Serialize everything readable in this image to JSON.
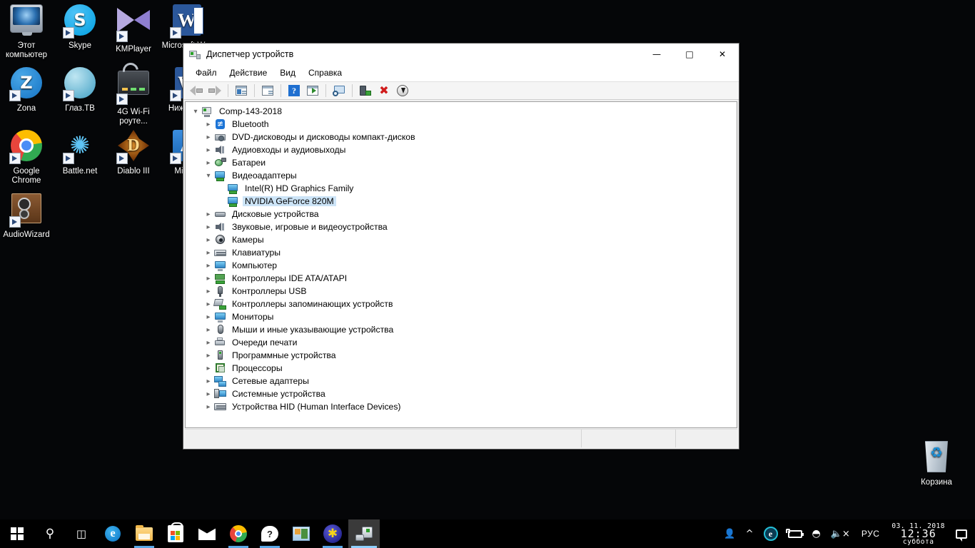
{
  "desktop": {
    "icons": [
      {
        "label": "Этот компьютер",
        "icon": "this-pc-icon",
        "shortcut": false
      },
      {
        "label": "Skype",
        "icon": "skype-icon",
        "shortcut": true
      },
      {
        "label": "KMPlayer",
        "icon": "kmplayer-icon",
        "shortcut": true
      },
      {
        "label": "Microsoft Wor",
        "icon": "microsoft-word-icon",
        "shortcut": true
      },
      {
        "label": "Zona",
        "icon": "zona-icon",
        "shortcut": true
      },
      {
        "label": "Глаз.ТВ",
        "icon": "glaz-tv-icon",
        "shortcut": true
      },
      {
        "label": "4G Wi-Fi роуте...",
        "icon": "wifi-router-icon",
        "shortcut": true
      },
      {
        "label": "Ниж Лелн",
        "icon": "word-doc-icon",
        "shortcut": true
      },
      {
        "label": "Google Chrome",
        "icon": "chrome-icon",
        "shortcut": true
      },
      {
        "label": "Battle.net",
        "icon": "battlenet-icon",
        "shortcut": true
      },
      {
        "label": "Diablo III",
        "icon": "diablo-icon",
        "shortcut": true
      },
      {
        "label": "Mic Ed",
        "icon": "microsoft-edge-blue-icon",
        "shortcut": true
      },
      {
        "label": "AudioWizard",
        "icon": "audiowizard-icon",
        "shortcut": true
      },
      {
        "label": "Корзина",
        "icon": "recycle-bin-icon",
        "shortcut": false
      }
    ]
  },
  "window": {
    "title": "Диспетчер устройств",
    "title_icon": "device-manager-icon",
    "controls": {
      "minimize": "—",
      "maximize": "□",
      "close": "✕"
    },
    "menu": [
      "Файл",
      "Действие",
      "Вид",
      "Справка"
    ],
    "toolbar": [
      {
        "name": "back-button",
        "icon": "arrow-left-icon"
      },
      {
        "name": "forward-button",
        "icon": "arrow-right-icon"
      },
      {
        "name": "separator-1",
        "icon": "separator"
      },
      {
        "name": "show-hide-console-tree-button",
        "icon": "console-tree-icon"
      },
      {
        "name": "separator-2",
        "icon": "separator"
      },
      {
        "name": "properties-button",
        "icon": "properties-icon"
      },
      {
        "name": "separator-3",
        "icon": "separator"
      },
      {
        "name": "help-button",
        "icon": "help-icon"
      },
      {
        "name": "update-driver-button",
        "icon": "update-driver-icon"
      },
      {
        "name": "separator-4",
        "icon": "separator"
      },
      {
        "name": "scan-hardware-changes-button",
        "icon": "scan-hardware-icon"
      },
      {
        "name": "separator-5",
        "icon": "separator"
      },
      {
        "name": "enable-device-button",
        "icon": "enable-device-icon"
      },
      {
        "name": "uninstall-device-button",
        "icon": "uninstall-red-x-icon"
      },
      {
        "name": "disable-device-button",
        "icon": "disable-device-icon"
      }
    ],
    "tree": [
      {
        "label": "Comp-143-2018",
        "depth": 0,
        "state": "expanded",
        "icon": "computer-node-icon",
        "selected": false
      },
      {
        "label": "Bluetooth",
        "depth": 1,
        "state": "collapsed",
        "icon": "bluetooth-icon",
        "selected": false
      },
      {
        "label": "DVD-дисководы и дисководы компакт-дисков",
        "depth": 1,
        "state": "collapsed",
        "icon": "dvd-drive-icon",
        "selected": false
      },
      {
        "label": "Аудиовходы и аудиовыходы",
        "depth": 1,
        "state": "collapsed",
        "icon": "audio-io-icon",
        "selected": false
      },
      {
        "label": "Батареи",
        "depth": 1,
        "state": "collapsed",
        "icon": "battery-icon",
        "selected": false
      },
      {
        "label": "Видеоадаптеры",
        "depth": 1,
        "state": "expanded",
        "icon": "display-adapter-icon",
        "selected": false
      },
      {
        "label": "Intel(R) HD Graphics Family",
        "depth": 2,
        "state": "leaf",
        "icon": "display-adapter-icon",
        "selected": false
      },
      {
        "label": "NVIDIA GeForce 820M",
        "depth": 2,
        "state": "leaf",
        "icon": "display-adapter-icon",
        "selected": true
      },
      {
        "label": "Дисковые устройства",
        "depth": 1,
        "state": "collapsed",
        "icon": "disk-drive-icon",
        "selected": false
      },
      {
        "label": "Звуковые, игровые и видеоустройства",
        "depth": 1,
        "state": "collapsed",
        "icon": "audio-io-icon",
        "selected": false
      },
      {
        "label": "Камеры",
        "depth": 1,
        "state": "collapsed",
        "icon": "camera-icon",
        "selected": false
      },
      {
        "label": "Клавиатуры",
        "depth": 1,
        "state": "collapsed",
        "icon": "keyboard-icon",
        "selected": false
      },
      {
        "label": "Компьютер",
        "depth": 1,
        "state": "collapsed",
        "icon": "monitor-icon",
        "selected": false
      },
      {
        "label": "Контроллеры IDE ATA/ATAPI",
        "depth": 1,
        "state": "collapsed",
        "icon": "ide-controller-icon",
        "selected": false
      },
      {
        "label": "Контроллеры USB",
        "depth": 1,
        "state": "collapsed",
        "icon": "usb-controller-icon",
        "selected": false
      },
      {
        "label": "Контроллеры запоминающих устройств",
        "depth": 1,
        "state": "collapsed",
        "icon": "storage-controller-icon",
        "selected": false
      },
      {
        "label": "Мониторы",
        "depth": 1,
        "state": "collapsed",
        "icon": "monitor-icon",
        "selected": false
      },
      {
        "label": "Мыши и иные указывающие устройства",
        "depth": 1,
        "state": "collapsed",
        "icon": "mouse-icon",
        "selected": false
      },
      {
        "label": "Очереди печати",
        "depth": 1,
        "state": "collapsed",
        "icon": "printer-icon",
        "selected": false
      },
      {
        "label": "Программные устройства",
        "depth": 1,
        "state": "collapsed",
        "icon": "software-device-icon",
        "selected": false
      },
      {
        "label": "Процессоры",
        "depth": 1,
        "state": "collapsed",
        "icon": "processor-icon",
        "selected": false
      },
      {
        "label": "Сетевые адаптеры",
        "depth": 1,
        "state": "collapsed",
        "icon": "network-adapter-icon",
        "selected": false
      },
      {
        "label": "Системные устройства",
        "depth": 1,
        "state": "collapsed",
        "icon": "system-device-icon",
        "selected": false
      },
      {
        "label": "Устройства HID (Human Interface Devices)",
        "depth": 1,
        "state": "collapsed",
        "icon": "hid-device-icon",
        "selected": false
      }
    ],
    "statusbar": {
      "pane1": "",
      "pane2": "",
      "pane3": ""
    }
  },
  "taskbar": {
    "buttons": [
      {
        "name": "start-button",
        "icon": "windows-logo-icon",
        "active": false,
        "running": false
      },
      {
        "name": "search-button",
        "icon": "search-icon",
        "active": false,
        "running": false
      },
      {
        "name": "task-view-button",
        "icon": "task-view-icon",
        "active": false,
        "running": false
      },
      {
        "name": "edge-button",
        "icon": "microsoft-edge-icon",
        "active": false,
        "running": false
      },
      {
        "name": "file-explorer-button",
        "icon": "file-explorer-icon",
        "active": false,
        "running": true
      },
      {
        "name": "store-button",
        "icon": "microsoft-store-icon",
        "active": false,
        "running": false
      },
      {
        "name": "mail-button",
        "icon": "mail-icon",
        "active": false,
        "running": false
      },
      {
        "name": "chrome-button",
        "icon": "chrome-icon",
        "active": false,
        "running": true
      },
      {
        "name": "support-button",
        "icon": "get-help-icon",
        "active": false,
        "running": true
      },
      {
        "name": "office-button",
        "icon": "office-icon",
        "active": false,
        "running": false
      },
      {
        "name": "asterisk-button",
        "icon": "asterisk-app-icon",
        "active": false,
        "running": true
      },
      {
        "name": "device-manager-taskbar-button",
        "icon": "device-manager-icon",
        "active": true,
        "running": true
      }
    ],
    "tray": {
      "people": "people-icon",
      "show_hidden": "chevron-up-icon",
      "edge_notification": "edge-tray-icon",
      "battery": "battery-charging-icon",
      "network": "wifi-icon",
      "volume": "volume-muted-icon",
      "language": "РУС",
      "clock": {
        "date": "03. 11. 2018",
        "time": "12:36",
        "day": "суббота"
      },
      "action_center": "notification-icon"
    }
  },
  "colors": {
    "selection": "#cce4f7",
    "accent": "#0078d7",
    "taskbar_bg": "#000000",
    "window_bg": "#f0f0f0"
  }
}
